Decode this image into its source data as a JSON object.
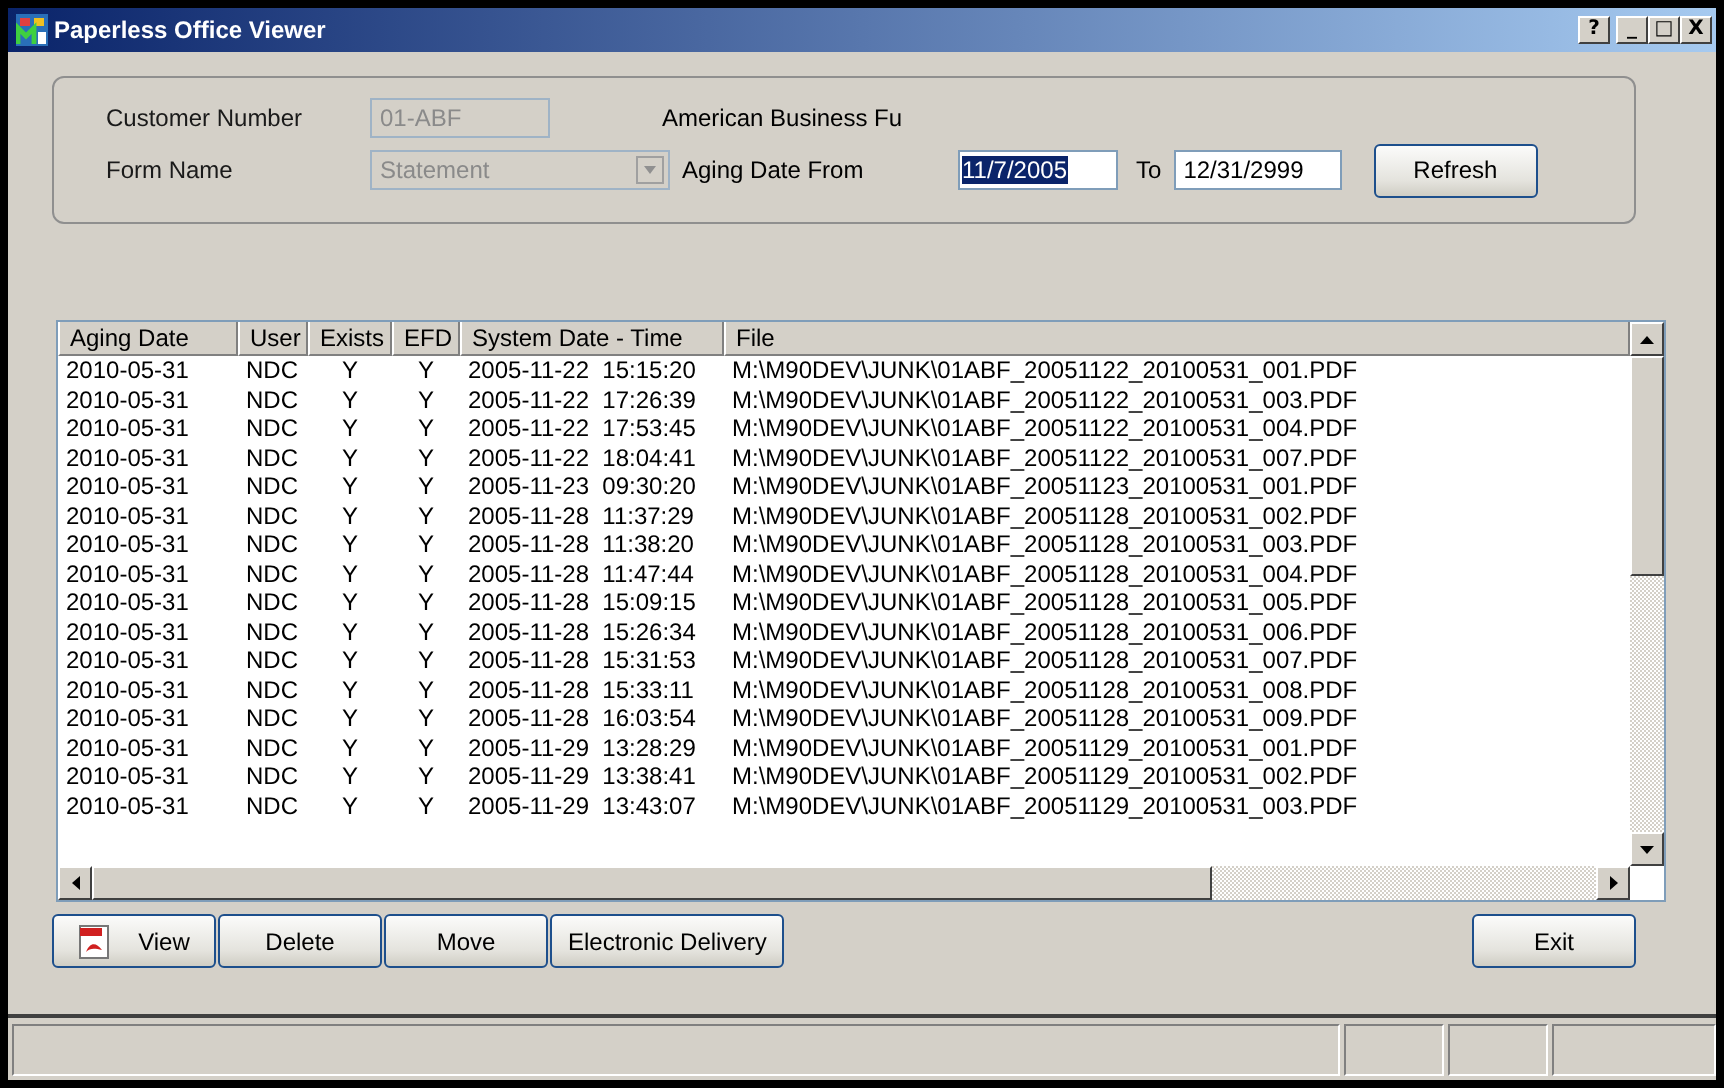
{
  "window": {
    "title": "Paperless Office Viewer",
    "controls": [
      "?",
      "_",
      "□",
      "X"
    ]
  },
  "filters": {
    "customer_number_label": "Customer Number",
    "customer_number": "01-ABF",
    "customer_name": "American Business Fu",
    "form_name_label": "Form Name",
    "form_name": "Statement",
    "aging_from_label": "Aging Date From",
    "aging_from": "11/7/2005",
    "to_label": "To",
    "aging_to": "12/31/2999",
    "refresh": "Refresh"
  },
  "table": {
    "columns": [
      "Aging Date",
      "User",
      "Exists",
      "EFD",
      "System Date - Time",
      "File"
    ],
    "rows": [
      [
        "2010-05-31",
        "NDC",
        "Y",
        "Y",
        "2005-11-22  15:15:20",
        "M:\\M90DEV\\JUNK\\01ABF_20051122_20100531_001.PDF"
      ],
      [
        "2010-05-31",
        "NDC",
        "Y",
        "Y",
        "2005-11-22  17:26:39",
        "M:\\M90DEV\\JUNK\\01ABF_20051122_20100531_003.PDF"
      ],
      [
        "2010-05-31",
        "NDC",
        "Y",
        "Y",
        "2005-11-22  17:53:45",
        "M:\\M90DEV\\JUNK\\01ABF_20051122_20100531_004.PDF"
      ],
      [
        "2010-05-31",
        "NDC",
        "Y",
        "Y",
        "2005-11-22  18:04:41",
        "M:\\M90DEV\\JUNK\\01ABF_20051122_20100531_007.PDF"
      ],
      [
        "2010-05-31",
        "NDC",
        "Y",
        "Y",
        "2005-11-23  09:30:20",
        "M:\\M90DEV\\JUNK\\01ABF_20051123_20100531_001.PDF"
      ],
      [
        "2010-05-31",
        "NDC",
        "Y",
        "Y",
        "2005-11-28  11:37:29",
        "M:\\M90DEV\\JUNK\\01ABF_20051128_20100531_002.PDF"
      ],
      [
        "2010-05-31",
        "NDC",
        "Y",
        "Y",
        "2005-11-28  11:38:20",
        "M:\\M90DEV\\JUNK\\01ABF_20051128_20100531_003.PDF"
      ],
      [
        "2010-05-31",
        "NDC",
        "Y",
        "Y",
        "2005-11-28  11:47:44",
        "M:\\M90DEV\\JUNK\\01ABF_20051128_20100531_004.PDF"
      ],
      [
        "2010-05-31",
        "NDC",
        "Y",
        "Y",
        "2005-11-28  15:09:15",
        "M:\\M90DEV\\JUNK\\01ABF_20051128_20100531_005.PDF"
      ],
      [
        "2010-05-31",
        "NDC",
        "Y",
        "Y",
        "2005-11-28  15:26:34",
        "M:\\M90DEV\\JUNK\\01ABF_20051128_20100531_006.PDF"
      ],
      [
        "2010-05-31",
        "NDC",
        "Y",
        "Y",
        "2005-11-28  15:31:53",
        "M:\\M90DEV\\JUNK\\01ABF_20051128_20100531_007.PDF"
      ],
      [
        "2010-05-31",
        "NDC",
        "Y",
        "Y",
        "2005-11-28  15:33:11",
        "M:\\M90DEV\\JUNK\\01ABF_20051128_20100531_008.PDF"
      ],
      [
        "2010-05-31",
        "NDC",
        "Y",
        "Y",
        "2005-11-28  16:03:54",
        "M:\\M90DEV\\JUNK\\01ABF_20051128_20100531_009.PDF"
      ],
      [
        "2010-05-31",
        "NDC",
        "Y",
        "Y",
        "2005-11-29  13:28:29",
        "M:\\M90DEV\\JUNK\\01ABF_20051129_20100531_001.PDF"
      ],
      [
        "2010-05-31",
        "NDC",
        "Y",
        "Y",
        "2005-11-29  13:38:41",
        "M:\\M90DEV\\JUNK\\01ABF_20051129_20100531_002.PDF"
      ],
      [
        "2010-05-31",
        "NDC",
        "Y",
        "Y",
        "2005-11-29  13:43:07",
        "M:\\M90DEV\\JUNK\\01ABF_20051129_20100531_003.PDF"
      ]
    ]
  },
  "buttons": [
    {
      "label": "View",
      "kind": "pdf"
    },
    {
      "label": "Delete",
      "kind": "plain"
    },
    {
      "label": "Move",
      "kind": "plain"
    },
    {
      "label": "Electronic Delivery",
      "kind": "plain"
    }
  ],
  "exit": "Exit"
}
